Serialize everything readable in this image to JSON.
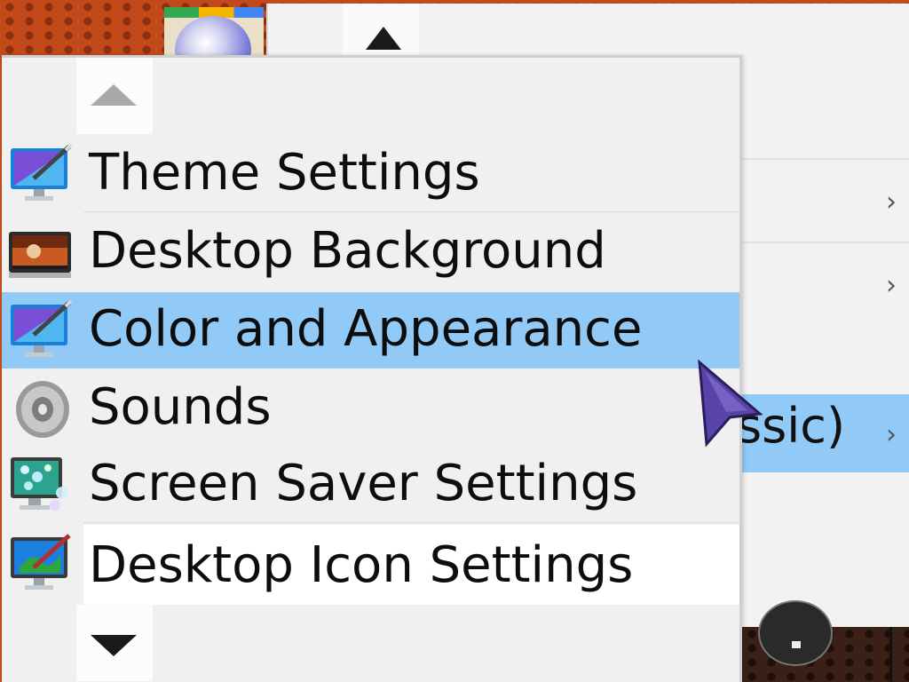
{
  "parent_menu": {
    "highlighted_item_partial_label": "ssic)",
    "chevron": "›"
  },
  "submenu": {
    "items": [
      {
        "label": "Theme Settings",
        "icon": "theme-settings-icon"
      },
      {
        "label": "Desktop Background",
        "icon": "desktop-background-icon"
      },
      {
        "label": "Color and Appearance",
        "icon": "color-appearance-icon",
        "selected": true
      },
      {
        "label": "Sounds",
        "icon": "speaker-icon"
      },
      {
        "label": "Screen Saver Settings",
        "icon": "screen-saver-icon"
      },
      {
        "label": "Desktop Icon Settings",
        "icon": "desktop-icon-settings-icon"
      }
    ]
  },
  "colors": {
    "highlight": "#91c9f7",
    "menu_bg": "#f0f0f0"
  }
}
